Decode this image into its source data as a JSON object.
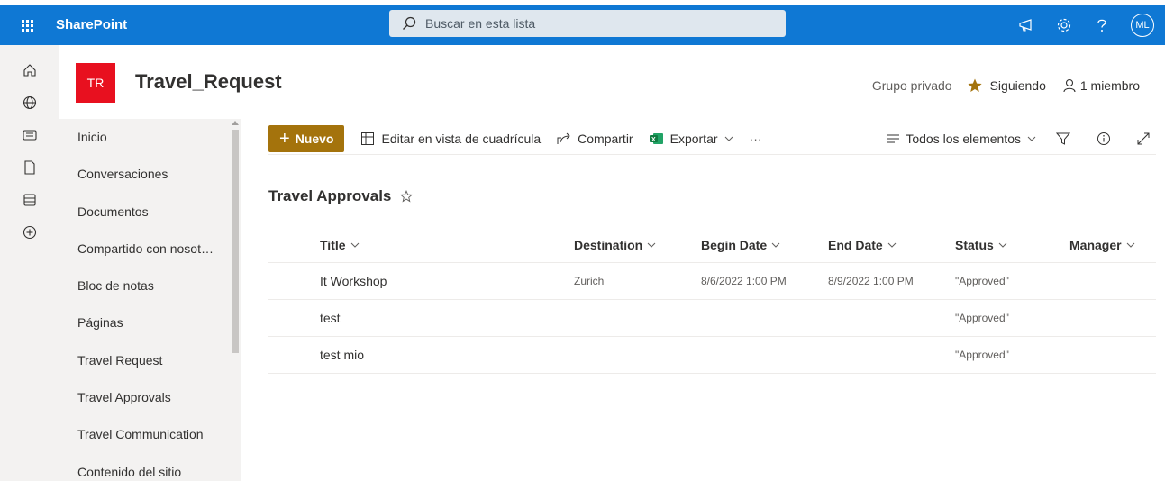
{
  "suitebar": {
    "app_name": "SharePoint",
    "search_placeholder": "Buscar en esta lista",
    "avatar_initials": "ML"
  },
  "site": {
    "logo_text": "TR",
    "logo_color": "#e8101f",
    "title": "Travel_Request",
    "privacy": "Grupo privado",
    "follow_label": "Siguiendo",
    "members_label": "1 miembro"
  },
  "nav": {
    "items": [
      "Inicio",
      "Conversaciones",
      "Documentos",
      "Compartido con nosot…",
      "Bloc de notas",
      "Páginas",
      "Travel Request",
      "Travel Approvals",
      "Travel Communication",
      "Contenido del sitio"
    ]
  },
  "commandbar": {
    "new_label": "Nuevo",
    "grid_edit_label": "Editar en vista de cuadrícula",
    "share_label": "Compartir",
    "export_label": "Exportar",
    "more_label": "···",
    "view_label": "Todos los elementos",
    "new_button_color": "#a4730c"
  },
  "list": {
    "title": "Travel Approvals",
    "columns": {
      "title": "Title",
      "destination": "Destination",
      "begin": "Begin Date",
      "end": "End Date",
      "status": "Status",
      "manager": "Manager"
    },
    "rows": [
      {
        "title": "It Workshop",
        "destination": "Zurich",
        "begin": "8/6/2022 1:00 PM",
        "end": "8/9/2022 1:00 PM",
        "status": "\"Approved\"",
        "manager": ""
      },
      {
        "title": "test",
        "destination": "",
        "begin": "",
        "end": "",
        "status": "\"Approved\"",
        "manager": ""
      },
      {
        "title": "test mio",
        "destination": "",
        "begin": "",
        "end": "",
        "status": "\"Approved\"",
        "manager": ""
      }
    ]
  },
  "colors": {
    "suitebar": "#0f78d4",
    "accent_star": "#a4730c"
  }
}
